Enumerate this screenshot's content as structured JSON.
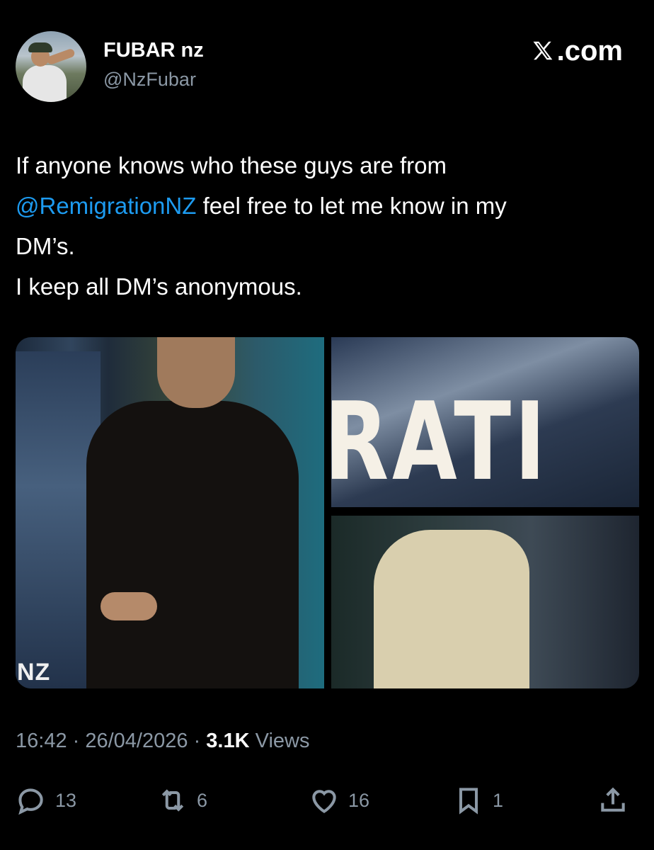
{
  "author": {
    "display_name": "FUBAR nz",
    "handle": "@NzFubar",
    "avatar_icon": "profile-photo"
  },
  "brand": {
    "label": ".com",
    "icon": "x-logo-icon"
  },
  "tweet": {
    "lines": [
      {
        "text": "If anyone knows who these guys are from"
      },
      {
        "mention": "@RemigrationNZ",
        "text": " feel free to let me know in my"
      },
      {
        "text": "DM’s."
      },
      {
        "text": "I keep all DM’s anonymous."
      }
    ]
  },
  "media": {
    "photo_left_caption": "NZ",
    "photo_top_right_caption": "RATI"
  },
  "meta": {
    "time": "16:42",
    "separator1": " · ",
    "date": "26/04/2026",
    "separator2": " · ",
    "views_count": "3.1K",
    "views_label": " Views"
  },
  "actions": {
    "reply": {
      "icon": "reply-icon",
      "count": "13"
    },
    "retweet": {
      "icon": "retweet-icon",
      "count": "6"
    },
    "like": {
      "icon": "heart-icon",
      "count": "16"
    },
    "bookmark": {
      "icon": "bookmark-icon",
      "count": "1"
    },
    "share": {
      "icon": "share-icon"
    }
  },
  "colors": {
    "background": "#000000",
    "text": "#ffffff",
    "secondary": "#8b98a5",
    "link": "#1d9bf0"
  }
}
